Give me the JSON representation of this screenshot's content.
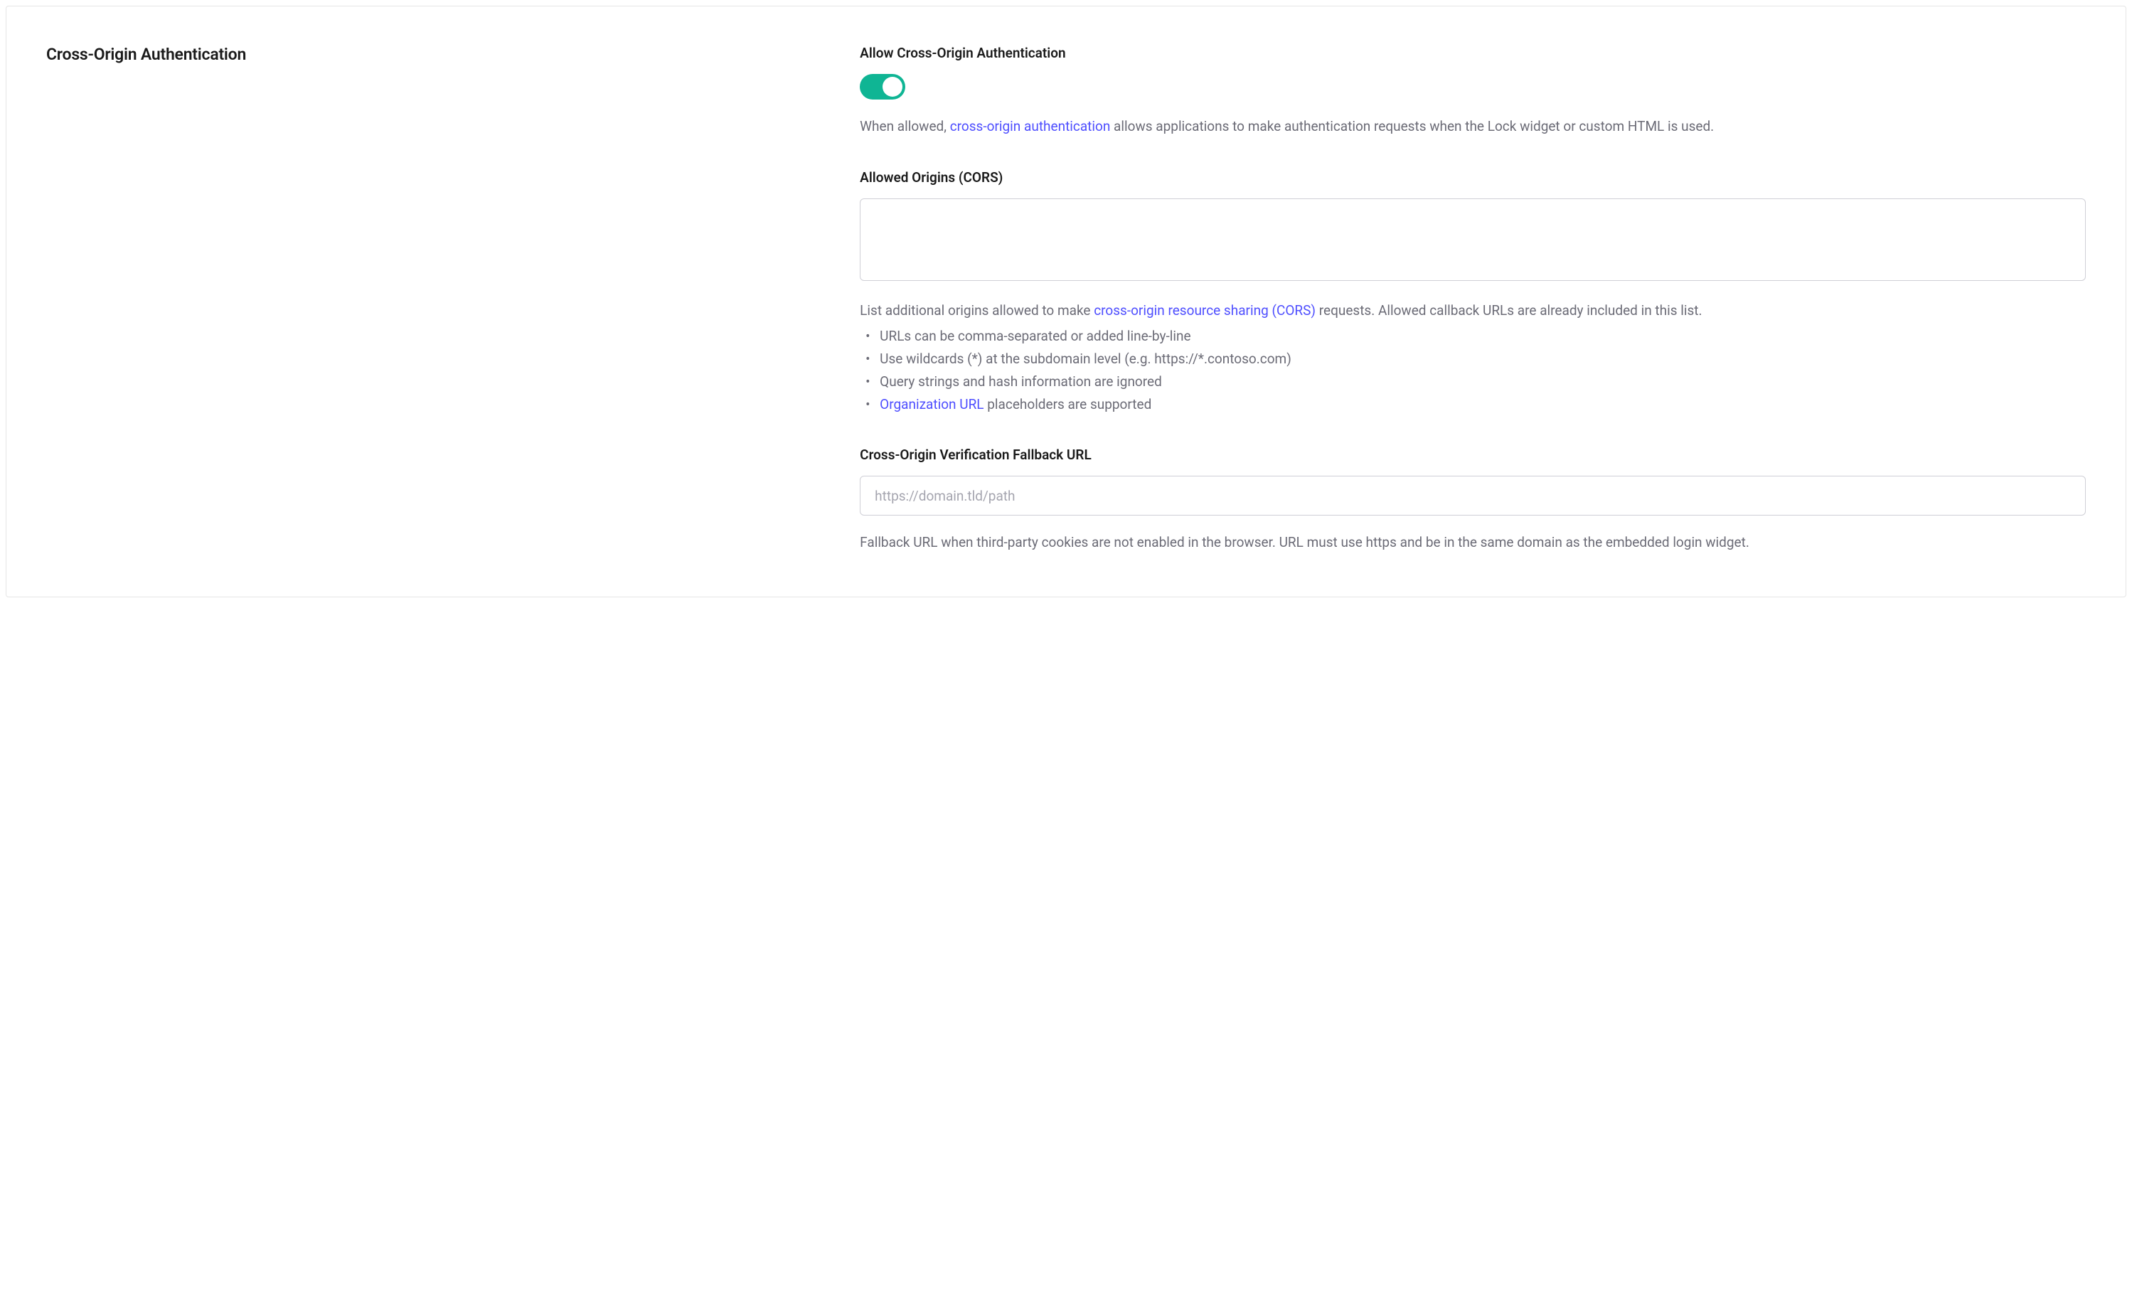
{
  "section": {
    "title": "Cross-Origin Authentication"
  },
  "allow": {
    "label": "Allow Cross-Origin Authentication",
    "toggle_on": true,
    "desc_pre": "When allowed, ",
    "desc_link": "cross-origin authentication",
    "desc_post": " allows applications to make authentication requests when the Lock widget or custom HTML is used."
  },
  "origins": {
    "label": "Allowed Origins (CORS)",
    "value": "",
    "desc_pre": "List additional origins allowed to make ",
    "desc_link": "cross-origin resource sharing (CORS)",
    "desc_post": " requests. Allowed callback URLs are already included in this list.",
    "hints": {
      "0": "URLs can be comma-separated or added line-by-line",
      "1": "Use wildcards (*) at the subdomain level (e.g. https://*.contoso.com)",
      "2": "Query strings and hash information are ignored",
      "3_link": "Organization URL",
      "3_post": " placeholders are supported"
    }
  },
  "fallback": {
    "label": "Cross-Origin Verification Fallback URL",
    "value": "",
    "placeholder": "https://domain.tld/path",
    "desc": "Fallback URL when third-party cookies are not enabled in the browser. URL must use https and be in the same domain as the embedded login widget."
  }
}
